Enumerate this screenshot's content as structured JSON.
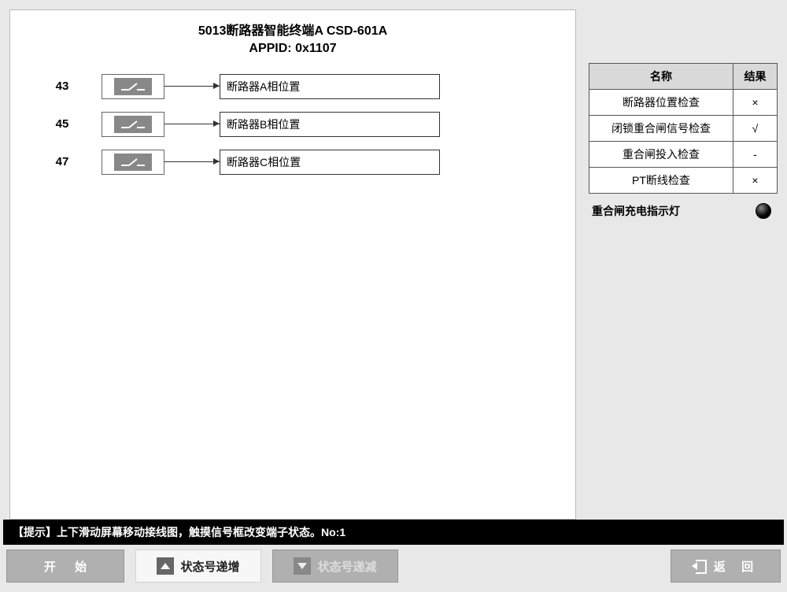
{
  "header": {
    "title_line1": "5013断路器智能终端A CSD-601A",
    "title_line2": "APPID: 0x1107"
  },
  "rows": [
    {
      "idx": "43",
      "label": "断路器A相位置"
    },
    {
      "idx": "45",
      "label": "断路器B相位置"
    },
    {
      "idx": "47",
      "label": "断路器C相位置"
    }
  ],
  "result_table": {
    "col_name": "名称",
    "col_result": "结果",
    "items": [
      {
        "name": "断路器位置检查",
        "result": "×"
      },
      {
        "name": "闭锁重合闸信号检查",
        "result": "√"
      },
      {
        "name": "重合闸投入检查",
        "result": "-"
      },
      {
        "name": "PT断线检查",
        "result": "×"
      }
    ]
  },
  "indicator": {
    "label": "重合闸充电指示灯"
  },
  "tip": "【提示】上下滑动屏幕移动接线图，触摸信号框改变端子状态。No:1",
  "buttons": {
    "start": "开 始",
    "inc": "状态号递增",
    "dec": "状态号递减",
    "back": "返 回"
  }
}
